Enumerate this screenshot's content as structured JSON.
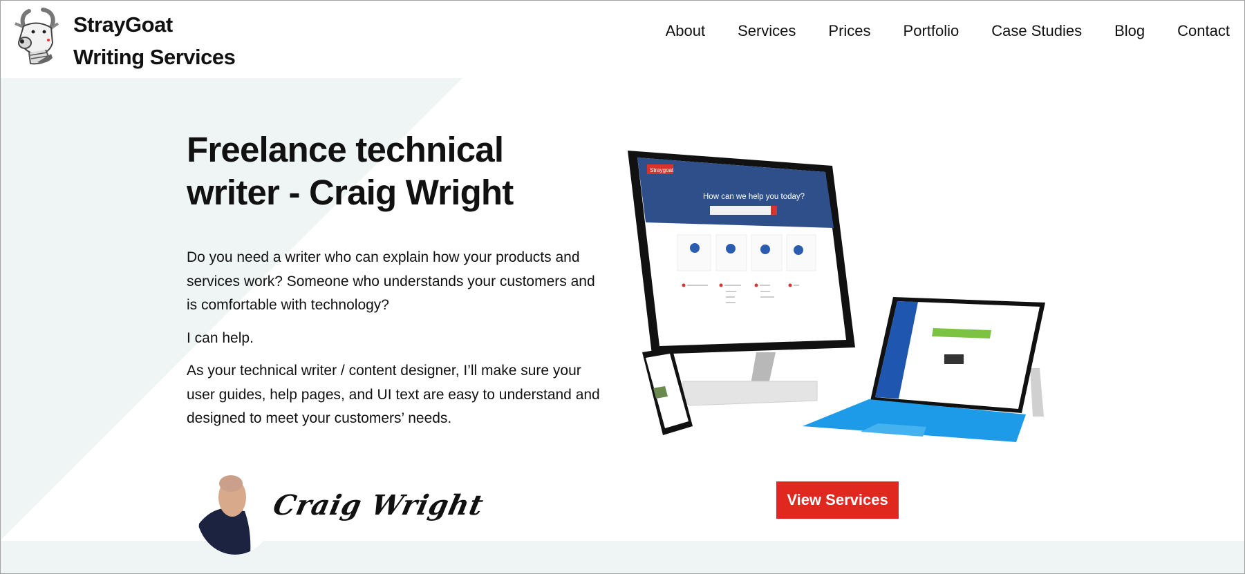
{
  "header": {
    "logo_line1": "StrayGoat",
    "logo_line2": "Writing Services",
    "logo_icon": "goat-mascot",
    "nav": [
      {
        "label": "About"
      },
      {
        "label": "Services"
      },
      {
        "label": "Prices"
      },
      {
        "label": "Portfolio"
      },
      {
        "label": "Case Studies"
      },
      {
        "label": "Blog"
      },
      {
        "label": "Contact"
      }
    ]
  },
  "hero": {
    "title_line1": "Freelance technical",
    "title_line2": "writer - Craig Wright",
    "paragraphs": [
      "Do you need a writer who can explain how your products and services work? Someone who understands your customers and is comfortable with technology?",
      "I can help.",
      "As your technical writer / content designer, I’ll make sure your user guides, help pages, and UI text are easy to understand and designed to meet your customers’ needs."
    ],
    "devices_image": {
      "monitor_heading": "How can we help you today?",
      "monitor_logo": "Straygoat"
    },
    "signature": "Craig Wright",
    "cta_label": "View Services"
  },
  "colors": {
    "accent": "#e0281f",
    "band": "#eff4f4",
    "help_blue": "#2f4f8a",
    "keyboard_blue": "#1e9be8"
  }
}
